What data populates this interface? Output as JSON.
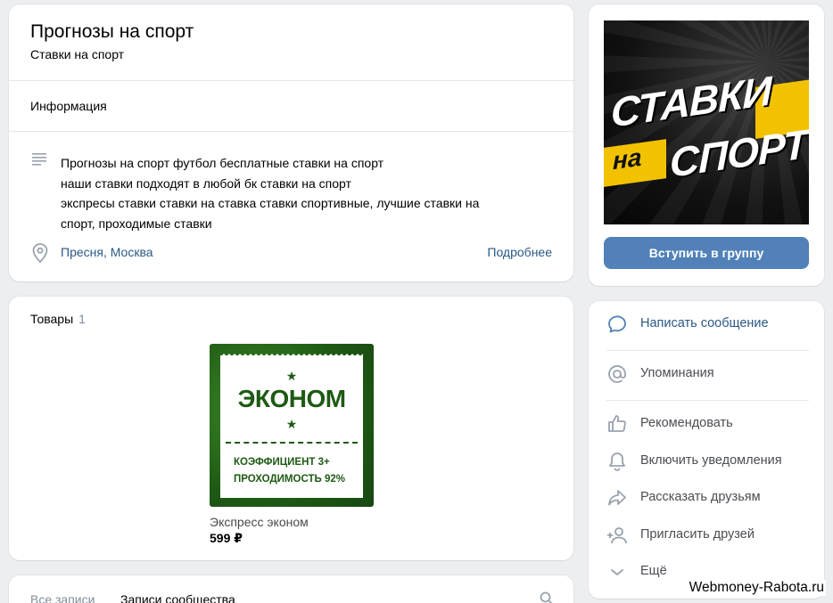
{
  "group": {
    "title": "Прогнозы на спорт",
    "status": "Ставки на спорт",
    "info_title": "Информация",
    "description_lines": [
      "Прогнозы на спорт футбол бесплатные ставки на спорт",
      "наши ставки подходят в любой бк ставки на спорт",
      "экспресы ставки ставки на ставка ставки спортивные, лучшие ставки на",
      "спорт, проходимые ставки"
    ],
    "location": "Пресня, Москва",
    "more_link": "Подробнее"
  },
  "products": {
    "heading": "Товары",
    "count": "1",
    "items": [
      {
        "name": "Экспресс эконом",
        "price": "599 ₽",
        "image_title": "ЭКОНОМ",
        "image_line1": "КОЭФФИЦИЕНТ 3+",
        "image_line2": "ПРОХОДИМОСТЬ 92%"
      }
    ]
  },
  "posts": {
    "tab_all": "Все записи",
    "tab_community": "Записи сообщества"
  },
  "cover": {
    "text_top": "СТАВКИ",
    "text_mid": "на",
    "text_bottom": "СПОРТ",
    "accent_color": "#f2c200"
  },
  "join_button": "Вступить в группу",
  "actions": [
    {
      "label": "Написать сообщение",
      "icon": "message-icon"
    },
    {
      "label": "Упоминания",
      "icon": "at-icon"
    },
    {
      "label": "Рекомендовать",
      "icon": "thumbs-up-icon"
    },
    {
      "label": "Включить уведомления",
      "icon": "bell-icon"
    },
    {
      "label": "Рассказать друзьям",
      "icon": "share-icon"
    },
    {
      "label": "Пригласить друзей",
      "icon": "add-user-icon"
    },
    {
      "label": "Ещё",
      "icon": "chevron-down-icon"
    }
  ],
  "watermark": "Webmoney-Rabota.ru",
  "colors": {
    "link": "#2a5885",
    "button": "#5181b8",
    "background": "#edeef0"
  }
}
